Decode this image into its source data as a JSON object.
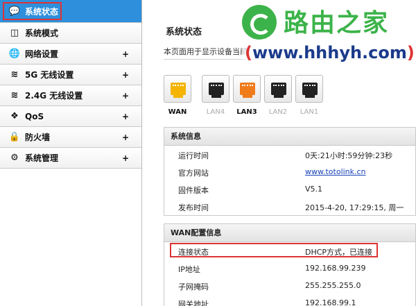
{
  "sidebar": {
    "items": [
      {
        "label": "系统状态",
        "icon": "chat-bubble-icon",
        "expandable": false,
        "active": true
      },
      {
        "label": "系统模式",
        "icon": "windows-icon",
        "expandable": false,
        "active": false
      },
      {
        "label": "网络设置",
        "icon": "globe-icon",
        "expandable": true,
        "active": false
      },
      {
        "label": "5G 无线设置",
        "icon": "wifi-icon",
        "expandable": true,
        "active": false
      },
      {
        "label": "2.4G 无线设置",
        "icon": "wifi-icon",
        "expandable": true,
        "active": false
      },
      {
        "label": "QoS",
        "icon": "move-icon",
        "expandable": true,
        "active": false
      },
      {
        "label": "防火墙",
        "icon": "lock-icon",
        "expandable": true,
        "active": false
      },
      {
        "label": "系统管理",
        "icon": "gear-icon",
        "expandable": true,
        "active": false
      }
    ],
    "expand_symbol": "+"
  },
  "main": {
    "title": "系统状态",
    "description": "本页面用于显示设备当前"
  },
  "logo": {
    "text": "路由之家",
    "url_open": "(",
    "url": "www.hhhyh.com",
    "url_close": ")"
  },
  "ports": [
    {
      "label": "WAN",
      "state": "active",
      "color": "#f4b400"
    },
    {
      "label": "LAN4",
      "state": "inactive",
      "color": "#222222"
    },
    {
      "label": "LAN3",
      "state": "active",
      "color": "#f07b1a"
    },
    {
      "label": "LAN2",
      "state": "inactive",
      "color": "#222222"
    },
    {
      "label": "LAN1",
      "state": "inactive",
      "color": "#222222"
    }
  ],
  "system_info": {
    "title": "系统信息",
    "rows": [
      {
        "label": "运行时间",
        "value": "0天:21小时:59分钟:23秒"
      },
      {
        "label": "官方网站",
        "value": "www.totolink.cn"
      },
      {
        "label": "固件版本",
        "value": "V5.1"
      },
      {
        "label": "发布时间",
        "value": "2015-4-20, 17:29:15, 周一"
      }
    ]
  },
  "wan_info": {
    "title": "WAN配置信息",
    "rows": [
      {
        "label": "连接状态",
        "value": "DHCP方式，已连接"
      },
      {
        "label": "IP地址",
        "value": "192.168.99.239"
      },
      {
        "label": "子网掩码",
        "value": "255.255.255.0"
      },
      {
        "label": "网关地址",
        "value": "192.168.99.1"
      }
    ]
  },
  "colors": {
    "active_nav": "#2e8fdc",
    "highlight_box": "#dd3333",
    "link": "#1a44b8",
    "logo_green": "#3cb34a"
  }
}
